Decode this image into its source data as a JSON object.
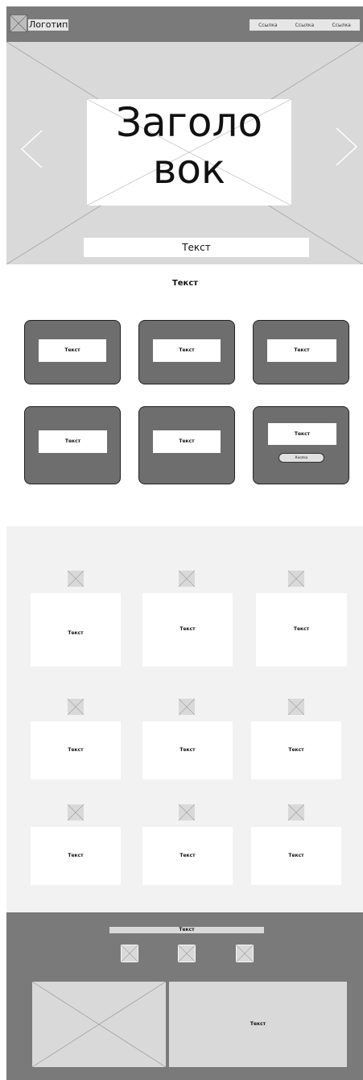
{
  "header": {
    "logo_label": "Логотип",
    "nav": [
      "Ссылка",
      "Ссылка",
      "Ссылка"
    ]
  },
  "hero": {
    "title_line1": "Заголо",
    "title_line2": "вок",
    "text": "Текст"
  },
  "services": {
    "title": "Текст",
    "cards": [
      "Текст",
      "Текст",
      "Текст",
      "Текст",
      "Текст",
      "Текст"
    ],
    "button_label": "Кнопка"
  },
  "features": {
    "items": [
      "Текст",
      "Текст",
      "Текст",
      "Текст",
      "Текст",
      "Текст",
      "Текст",
      "Текст",
      "Текст"
    ]
  },
  "footer": {
    "title": "Текст",
    "text": "Текст"
  },
  "colors": {
    "header_bg": "#7a7a7a",
    "hero_bg": "#d9d9d9",
    "card_bg": "#6e6e6e",
    "features_bg": "#f2f2f2"
  }
}
